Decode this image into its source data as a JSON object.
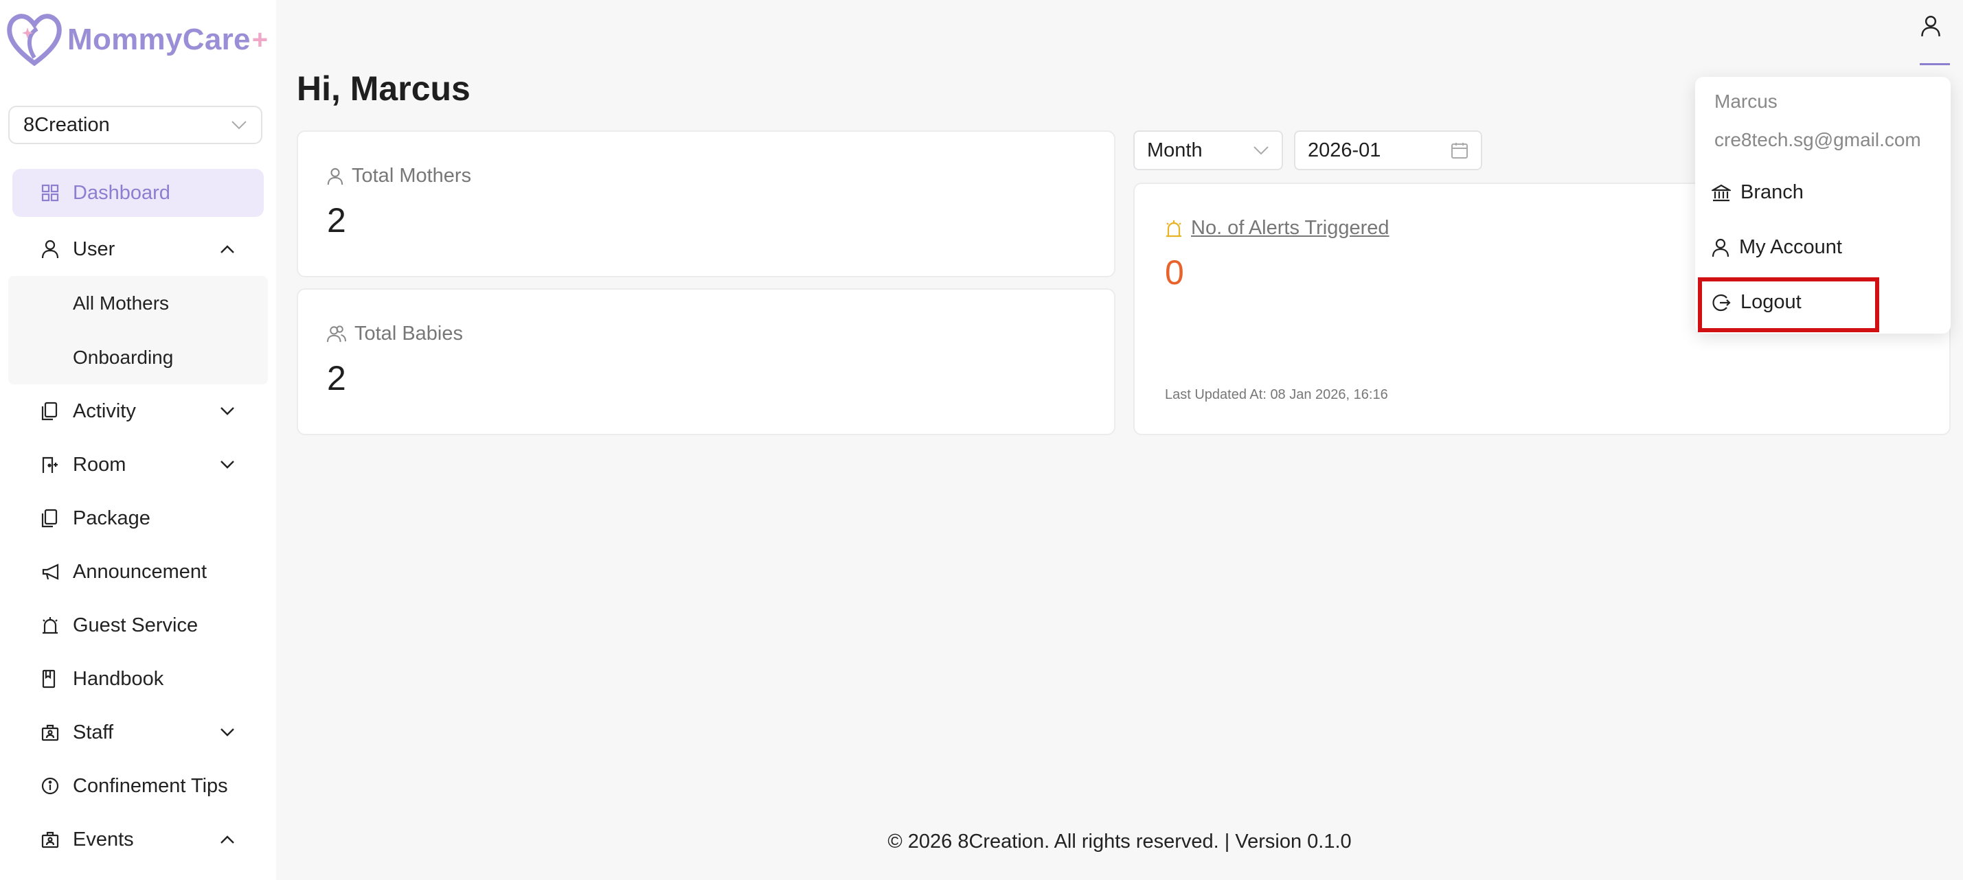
{
  "brand": {
    "name": "MommyCare",
    "plus": "+"
  },
  "branch_select": {
    "value": "8Creation"
  },
  "sidebar": {
    "items": [
      {
        "label": "Dashboard"
      },
      {
        "label": "User"
      },
      {
        "label": "All Mothers"
      },
      {
        "label": "Onboarding"
      },
      {
        "label": "Activity"
      },
      {
        "label": "Room"
      },
      {
        "label": "Package"
      },
      {
        "label": "Announcement"
      },
      {
        "label": "Guest Service"
      },
      {
        "label": "Handbook"
      },
      {
        "label": "Staff"
      },
      {
        "label": "Confinement Tips"
      },
      {
        "label": "Events"
      }
    ]
  },
  "main": {
    "greeting": "Hi, Marcus",
    "stats": [
      {
        "label": "Total Mothers",
        "value": "2"
      },
      {
        "label": "Total Babies",
        "value": "2"
      }
    ],
    "filters": {
      "period": "Month",
      "date": "2026-01"
    },
    "alerts": {
      "title": "No. of Alerts Triggered",
      "value": "0",
      "last_updated": "Last Updated At: 08 Jan 2026, 16:16"
    }
  },
  "user_menu": {
    "name": "Marcus",
    "email": "cre8tech.sg@gmail.com",
    "items": [
      {
        "label": "Branch"
      },
      {
        "label": "My Account"
      },
      {
        "label": "Logout"
      }
    ]
  },
  "footer": {
    "text": "© 2026 8Creation. All rights reserved. | Version 0.1.0"
  },
  "colors": {
    "accent": "#8c7fd0",
    "active_bg": "#ede9fb",
    "alert_value": "#e8622c",
    "alert_icon": "#e8b324",
    "highlight_box": "#d01012"
  }
}
